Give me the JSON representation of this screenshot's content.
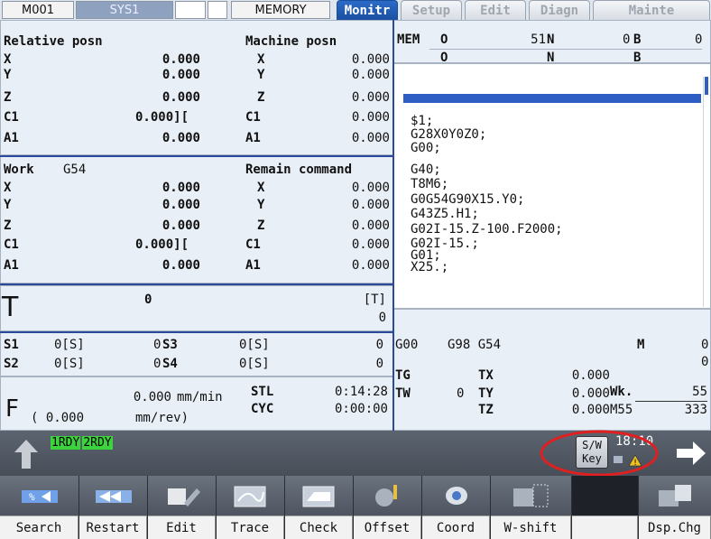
{
  "topbar": {
    "m001": "M001",
    "sys1": "SYS1",
    "memory": "MEMORY",
    "tabs": [
      {
        "label": "Monitr",
        "active": true
      },
      {
        "label": "Setup",
        "active": false
      },
      {
        "label": "Edit",
        "active": false
      },
      {
        "label": "Diagn",
        "active": false
      },
      {
        "label": "Mainte",
        "active": false
      }
    ]
  },
  "relative": {
    "title": "Relative posn",
    "rows": [
      {
        "axis": "X",
        "value": "0.000"
      },
      {
        "axis": "Y",
        "value": "0.000"
      },
      {
        "axis": "Z",
        "value": "0.000"
      },
      {
        "axis": "C1",
        "value": "0.000]["
      },
      {
        "axis": "A1",
        "value": "0.000"
      }
    ]
  },
  "machine": {
    "title": "Machine posn",
    "rows": [
      {
        "axis": "X",
        "value": "0.000"
      },
      {
        "axis": "Y",
        "value": "0.000"
      },
      {
        "axis": "Z",
        "value": "0.000"
      },
      {
        "axis": "C1",
        "value": "0.000"
      },
      {
        "axis": "A1",
        "value": "0.000"
      }
    ]
  },
  "work": {
    "title": "Work",
    "coord": "G54",
    "rows": [
      {
        "axis": "X",
        "value": "0.000"
      },
      {
        "axis": "Y",
        "value": "0.000"
      },
      {
        "axis": "Z",
        "value": "0.000"
      },
      {
        "axis": "C1",
        "value": "0.000]["
      },
      {
        "axis": "A1",
        "value": "0.000"
      }
    ]
  },
  "remain": {
    "title": "Remain command",
    "rows": [
      {
        "axis": "X",
        "value": "0.000"
      },
      {
        "axis": "Y",
        "value": "0.000"
      },
      {
        "axis": "Z",
        "value": "0.000"
      },
      {
        "axis": "C1",
        "value": "0.000"
      },
      {
        "axis": "A1",
        "value": "0.000"
      }
    ]
  },
  "mem_header": {
    "mode": "MEM",
    "o_label": "O",
    "o_value": "51",
    "n_label": "N",
    "n_value": "0",
    "b_label": "B",
    "b_value": "0",
    "o2_label": "O",
    "n2_label": "N",
    "b2_label": "B"
  },
  "program": {
    "lines": [
      "$1;",
      "G28X0Y0Z0;",
      "G00;",
      "G40;",
      "T8M6;",
      "G0G54G90X15.Y0;",
      "G43Z5.H1;",
      "G02I-15.Z-100.F2000;",
      "G02I-15.;",
      "G01;",
      "X25.;"
    ]
  },
  "tool": {
    "label": "T",
    "value": "0",
    "bracket": "[T]",
    "bracket_value": "0"
  },
  "spindle": {
    "s1_label": "S1",
    "s1_val": "0[S]",
    "s1_num": "0",
    "s3_label": "S3",
    "s3_val": "0[S]",
    "s3_num": "0",
    "s2_label": "S2",
    "s2_val": "0[S]",
    "s2_num": "0",
    "s4_label": "S4",
    "s4_val": "0[S]",
    "s4_num": "0"
  },
  "feed": {
    "label": "F",
    "mm_min_value": "0.000",
    "mm_min_unit": "mm/min",
    "mm_rev_value": "( 0.000",
    "mm_rev_unit": "mm/rev)"
  },
  "times": {
    "stl_label": "STL",
    "stl_value": "0:14:28",
    "cyc_label": "CYC",
    "cyc_value": "0:00:00"
  },
  "modal": {
    "g1": "G00",
    "g2": "G98 G54",
    "m_label": "M",
    "m_value": "0",
    "m_value2": "0",
    "tg_label": "TG",
    "tw_label": "TW",
    "tx_label": "TX",
    "tx_value": "0.000",
    "ty_label": "TY",
    "ty_value": "0.000",
    "ty_prefix": "0",
    "tz_label": "TZ",
    "tz_value": "0.000",
    "wk_label": "Wk.",
    "wk_value": "55",
    "m55_label": "M55",
    "m55_value": "333"
  },
  "status": {
    "rdy1": "1RDY",
    "rdy2": "2RDY",
    "swkey_line1": "S/W",
    "swkey_line2": "Key",
    "time": "18:10"
  },
  "softkeys": [
    {
      "label": "Search",
      "icon": "search-icon"
    },
    {
      "label": "Restart",
      "icon": "restart-icon"
    },
    {
      "label": "Edit",
      "icon": "edit-icon"
    },
    {
      "label": "Trace",
      "icon": "trace-icon"
    },
    {
      "label": "Check",
      "icon": "check-icon"
    },
    {
      "label": "Offset",
      "icon": "offset-icon"
    },
    {
      "label": "Coord",
      "icon": "coord-icon"
    },
    {
      "label": "W-shift",
      "icon": "w-shift-icon"
    },
    {
      "label": "",
      "icon": ""
    },
    {
      "label": "Dsp.Chg",
      "icon": "display-change-icon"
    }
  ],
  "colors": {
    "active_tab": "#1a4fa0",
    "panel_bg": "#e9eff6",
    "ready_green": "#3cd43c",
    "highlight_circle": "#e02020",
    "program_cursor": "#2e5ec4"
  }
}
